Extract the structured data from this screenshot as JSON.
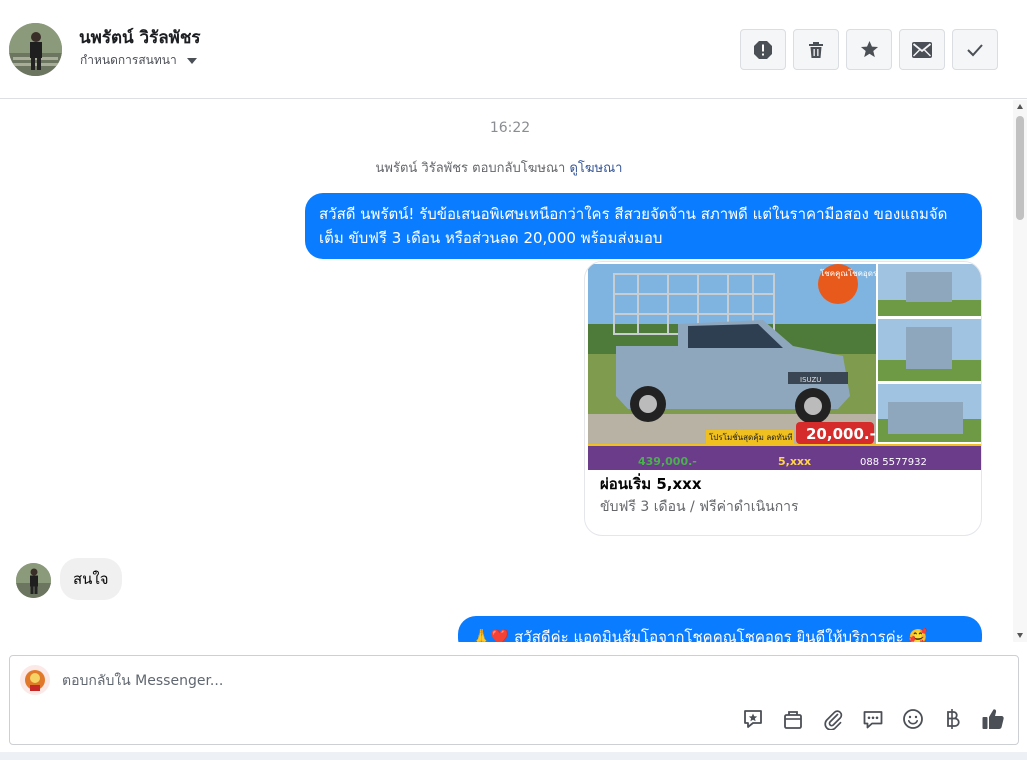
{
  "header": {
    "contact_name": "นพรัตน์ วิรัลพัชร",
    "status_label": "กำหนดการสนทนา",
    "actions": [
      "report-icon",
      "trash-icon",
      "star-icon",
      "envelope-icon",
      "check-icon"
    ]
  },
  "thread": {
    "timestamp": "16:22",
    "ad_reply_text": "นพรัตน์ วิรัลพัชร ตอบกลับโฆษณา",
    "ad_reply_link": "ดูโฆษณา",
    "message_out_1": "สวัสดี นพรัตน์! รับข้อเสนอพิเศษเหนือกว่าใคร สีสวยจัดจ้าน สภาพดี แต่ในราคามือสอง ของแถมจัดเต็ม ขับฟรี 3 เดือน หรือส่วนลด 20,000 พร้อมส่งมอบ",
    "card": {
      "title": "ผ่อนเริ่ม 5,xxx",
      "subtitle": "ขับฟรี 3 เดือน / ฟรีค่าดำเนินการ",
      "promo_badge": "20,000.-",
      "promo_banner": "โปรโมชั่นสุดคุ้ม ลดทันที",
      "brand": "ISUZU",
      "price_price": "439,000.-",
      "installment": "5,xxx",
      "phone": "088 5577932",
      "top_text": "โชคคูณโชคอุดร"
    },
    "message_in_1": "สนใจ",
    "message_out_2": "🙏❤️ สวัสดีค่ะ แอดมินส้มโอจากโชคคุณโชคอุดร ยินดีให้บริการค่ะ 🥰"
  },
  "composer": {
    "placeholder": "ตอบกลับใน Messenger...",
    "tools": [
      "sticker-icon",
      "gift-icon",
      "paperclip-icon",
      "saved-reply-icon",
      "emoji-icon",
      "baht-icon",
      "thumbs-up-icon"
    ]
  },
  "colors": {
    "bubble_out": "#0a7cff",
    "bubble_in": "#f0f0f0",
    "link": "#385898"
  }
}
